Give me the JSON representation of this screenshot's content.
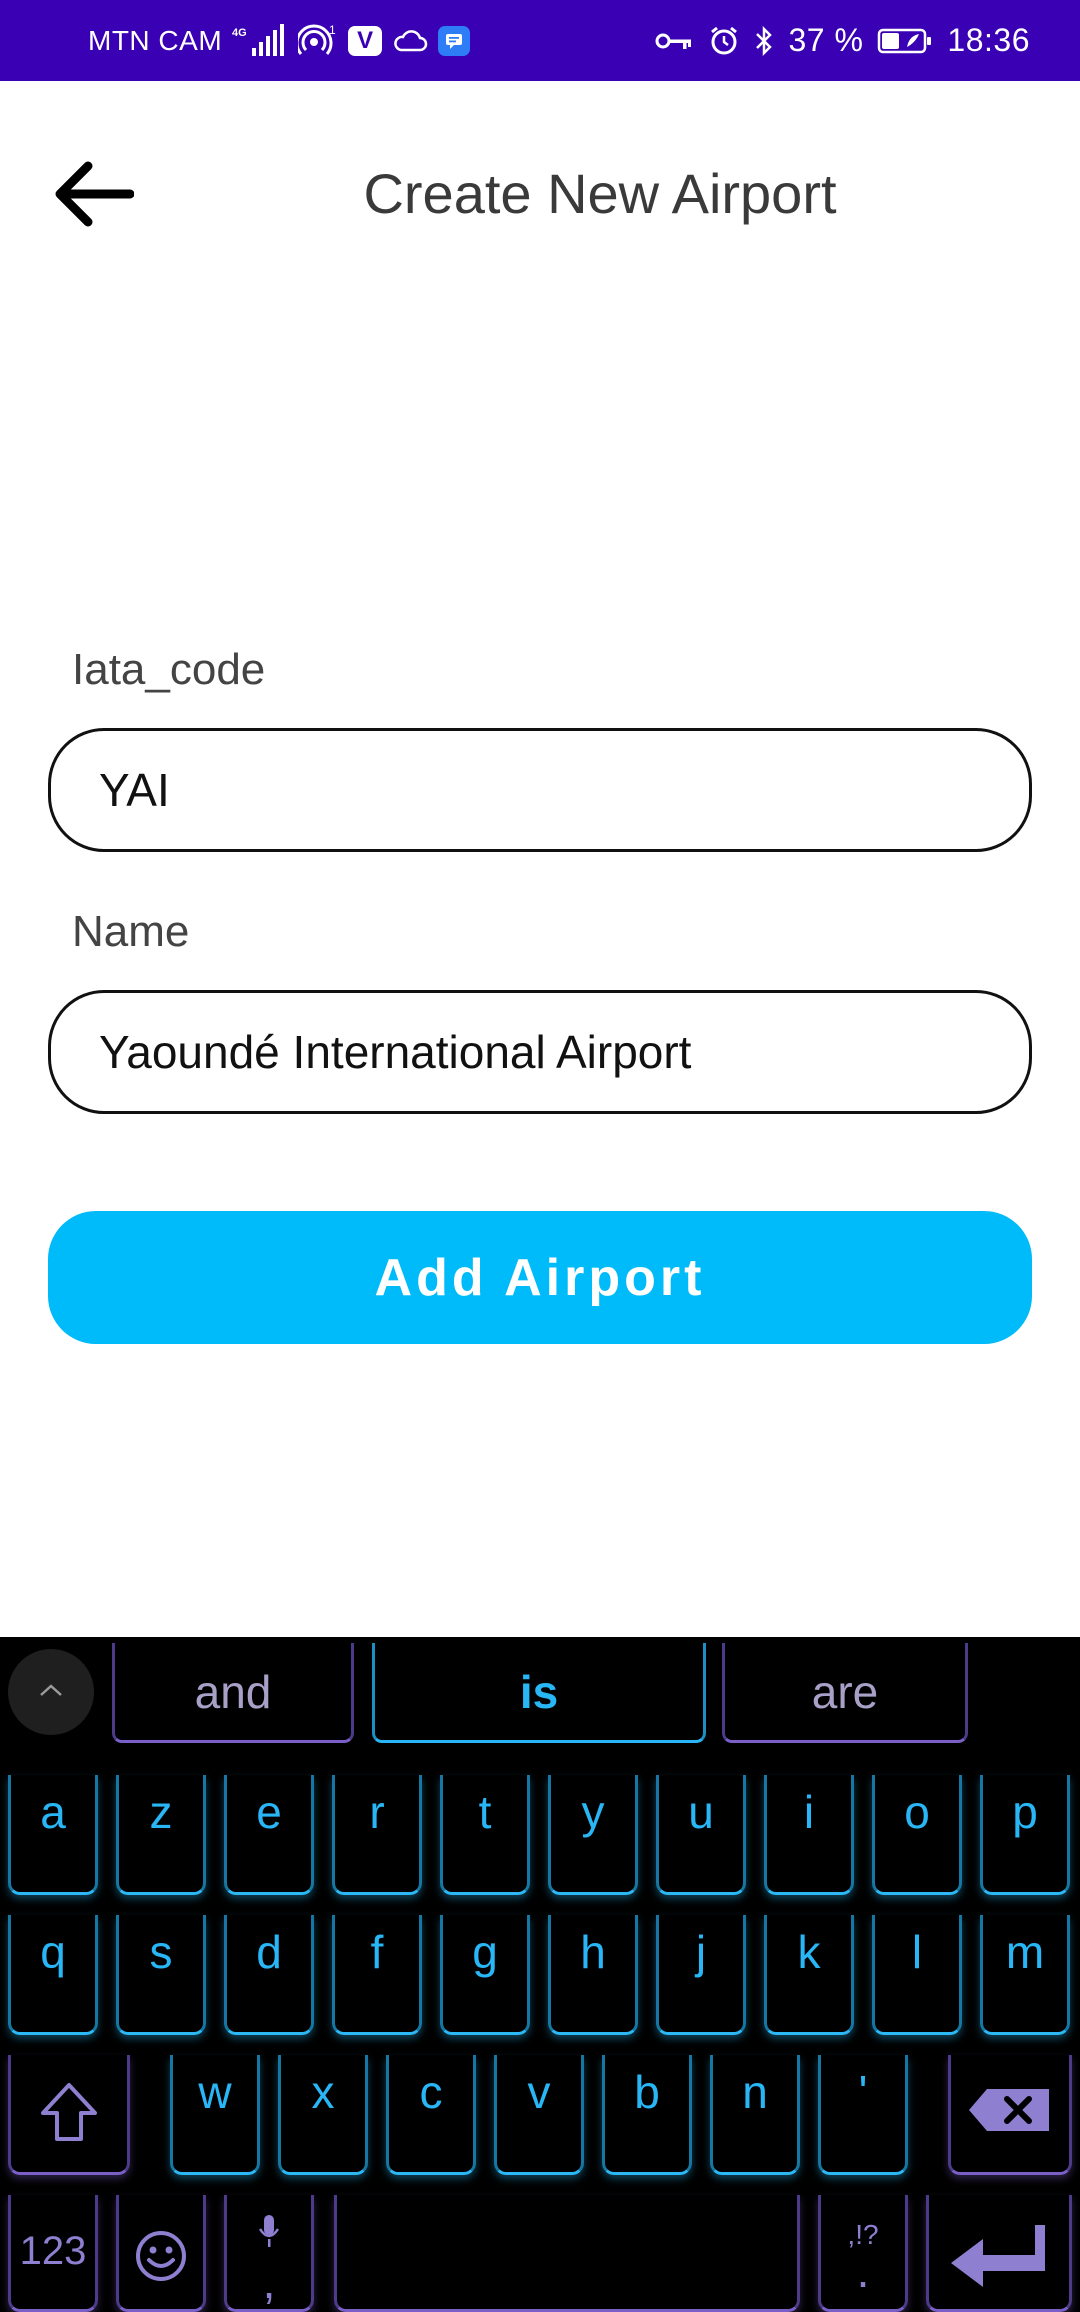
{
  "status_bar": {
    "carrier": "MTN CAM",
    "network": "4G",
    "hotspot_count": "1",
    "v_badge": "V",
    "battery": "37 %",
    "time": "18:36"
  },
  "header": {
    "title": "Create New Airport"
  },
  "form": {
    "iata_label": "Iata_code",
    "iata_value": "YAI",
    "name_label": "Name",
    "name_value": "Yaoundé International Airport",
    "submit_label": "Add Airport"
  },
  "keyboard": {
    "suggestions": [
      "and",
      "is",
      "are"
    ],
    "row1": [
      "a",
      "z",
      "e",
      "r",
      "t",
      "y",
      "u",
      "i",
      "o",
      "p"
    ],
    "row2": [
      "q",
      "s",
      "d",
      "f",
      "g",
      "h",
      "j",
      "k",
      "l",
      "m"
    ],
    "row3": [
      "w",
      "x",
      "c",
      "v",
      "b",
      "n",
      "'"
    ],
    "numbers_label": "123",
    "comma_label": ",",
    "period_label": ".",
    "punct_hint": ",!?"
  },
  "colors": {
    "status_bar": "#3a00b4",
    "accent": "#00bbf9",
    "keyboard_bg": "#000000",
    "key_blue": "#29b6f6",
    "key_purple": "#7a5fc6"
  }
}
